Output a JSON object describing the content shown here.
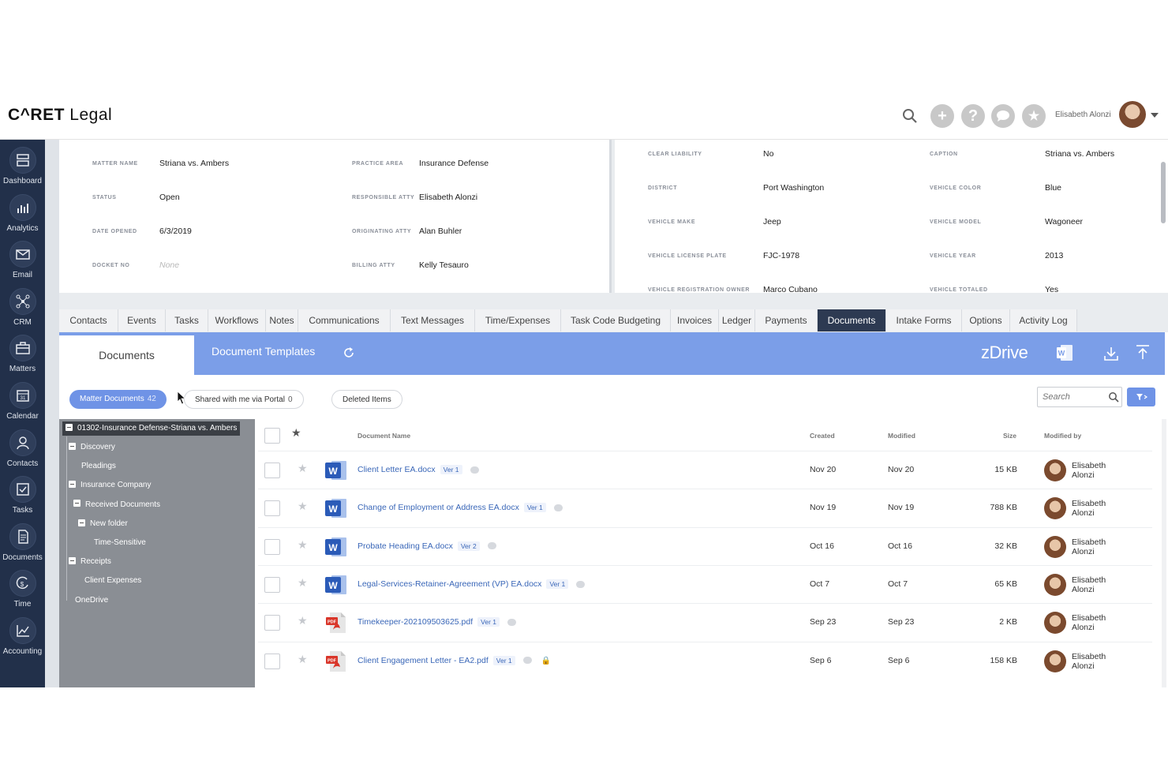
{
  "app": {
    "logo_caret": "C^RET",
    "logo_legal": "Legal"
  },
  "header": {
    "user_name": "Elisabeth Alonzi",
    "buttons": [
      {
        "icon": "plus-icon",
        "glyph": "+"
      },
      {
        "icon": "help-icon",
        "glyph": "?"
      },
      {
        "icon": "chat-icon",
        "glyph": ""
      },
      {
        "icon": "star-icon",
        "glyph": "★"
      }
    ]
  },
  "sidebar": {
    "items": [
      {
        "label": "Dashboard",
        "icon": "dashboard-icon"
      },
      {
        "label": "Analytics",
        "icon": "analytics-icon"
      },
      {
        "label": "Email",
        "icon": "email-icon"
      },
      {
        "label": "CRM",
        "icon": "crm-icon"
      },
      {
        "label": "Matters",
        "icon": "briefcase-icon"
      },
      {
        "label": "Calendar",
        "icon": "calendar-icon"
      },
      {
        "label": "Contacts",
        "icon": "contacts-icon"
      },
      {
        "label": "Tasks",
        "icon": "tasks-icon"
      },
      {
        "label": "Documents",
        "icon": "documents-icon"
      },
      {
        "label": "Time",
        "icon": "time-icon"
      },
      {
        "label": "Accounting",
        "icon": "accounting-icon"
      }
    ]
  },
  "matter_info": {
    "left": [
      {
        "label": "MATTER NAME",
        "value": "Striana vs. Ambers"
      },
      {
        "label": "STATUS",
        "value": "Open"
      },
      {
        "label": "DATE OPENED",
        "value": "6/3/2019"
      },
      {
        "label": "DOCKET NO",
        "value": "None"
      }
    ],
    "middle": [
      {
        "label": "PRACTICE AREA",
        "value": "Insurance Defense"
      },
      {
        "label": "RESPONSIBLE ATTY",
        "value": "Elisabeth Alonzi"
      },
      {
        "label": "ORIGINATING ATTY",
        "value": "Alan Buhler"
      },
      {
        "label": "BILLING ATTY",
        "value": "Kelly Tesauro"
      }
    ],
    "right_a": [
      {
        "label": "CLEAR LIABILITY",
        "value": "No"
      },
      {
        "label": "DISTRICT",
        "value": "Port Washington"
      },
      {
        "label": "VEHICLE MAKE",
        "value": "Jeep"
      },
      {
        "label": "VEHICLE LICENSE PLATE",
        "value": "FJC-1978"
      },
      {
        "label": "VEHICLE REGISTRATION OWNER",
        "value": "Marco Cubano"
      }
    ],
    "right_b": [
      {
        "label": "CAPTION",
        "value": "Striana vs. Ambers"
      },
      {
        "label": "VEHICLE COLOR",
        "value": "Blue"
      },
      {
        "label": "VEHICLE MODEL",
        "value": "Wagoneer"
      },
      {
        "label": "VEHICLE YEAR",
        "value": "2013"
      },
      {
        "label": "VEHICLE TOTALED",
        "value": "Yes"
      }
    ]
  },
  "tabs": [
    "Contacts",
    "Events",
    "Tasks",
    "Workflows",
    "Notes",
    "Communications",
    "Text Messages",
    "Time/Expenses",
    "Task Code Budgeting",
    "Invoices",
    "Ledger",
    "Payments",
    "Documents",
    "Intake Forms",
    "Options",
    "Activity Log"
  ],
  "active_tab": "Documents",
  "documents": {
    "subtab_documents": "Documents",
    "subtab_templates": "Document Templates",
    "zdrive": "zDrive",
    "filters": {
      "matter_docs": "Matter Documents",
      "matter_docs_count": "42",
      "shared": "Shared with me via Portal",
      "shared_count": "0",
      "deleted": "Deleted Items"
    },
    "search_placeholder": "Search",
    "tree": {
      "root": "01302-Insurance Defense-Striana vs. Ambers",
      "nodes": [
        "Discovery",
        "Pleadings",
        "Insurance Company",
        "Received Documents",
        "New folder",
        "Time-Sensitive",
        "Receipts",
        "Client Expenses",
        "OneDrive"
      ]
    },
    "columns": {
      "name": "Document Name",
      "created": "Created",
      "modified": "Modified",
      "size": "Size",
      "modified_by": "Modified by"
    },
    "rows": [
      {
        "name": "Client Letter EA.docx",
        "ver": "Ver 1",
        "type": "word",
        "created": "Nov 20",
        "modified": "Nov 20",
        "size": "15 KB",
        "by_first": "Elisabeth",
        "by_last": "Alonzi"
      },
      {
        "name": "Change of Employment or Address EA.docx",
        "ver": "Ver 1",
        "type": "word",
        "created": "Nov 19",
        "modified": "Nov 19",
        "size": "788 KB",
        "by_first": "Elisabeth",
        "by_last": "Alonzi"
      },
      {
        "name": "Probate Heading EA.docx",
        "ver": "Ver 2",
        "type": "word",
        "created": "Oct 16",
        "modified": "Oct 16",
        "size": "32 KB",
        "by_first": "Elisabeth",
        "by_last": "Alonzi"
      },
      {
        "name": "Legal-Services-Retainer-Agreement (VP) EA.docx",
        "ver": "Ver 1",
        "type": "word",
        "created": "Oct 7",
        "modified": "Oct 7",
        "size": "65 KB",
        "by_first": "Elisabeth",
        "by_last": "Alonzi"
      },
      {
        "name": "Timekeeper-202109503625.pdf",
        "ver": "Ver 1",
        "type": "pdf",
        "created": "Sep 23",
        "modified": "Sep 23",
        "size": "2 KB",
        "by_first": "Elisabeth",
        "by_last": "Alonzi"
      },
      {
        "name": "Client Engagement Letter - EA2.pdf",
        "ver": "Ver 1",
        "type": "pdf",
        "locked": true,
        "created": "Sep 6",
        "modified": "Sep 6",
        "size": "158 KB",
        "by_first": "Elisabeth",
        "by_last": "Alonzi"
      }
    ]
  },
  "colors": {
    "nav": "#22304a",
    "accent_blue": "#7b9ee8",
    "active_tab": "#2d3a52",
    "link": "#3a67b8",
    "tree_bg": "#8a8e94",
    "word": "#2b5bb8",
    "pdf": "#d9362a"
  }
}
